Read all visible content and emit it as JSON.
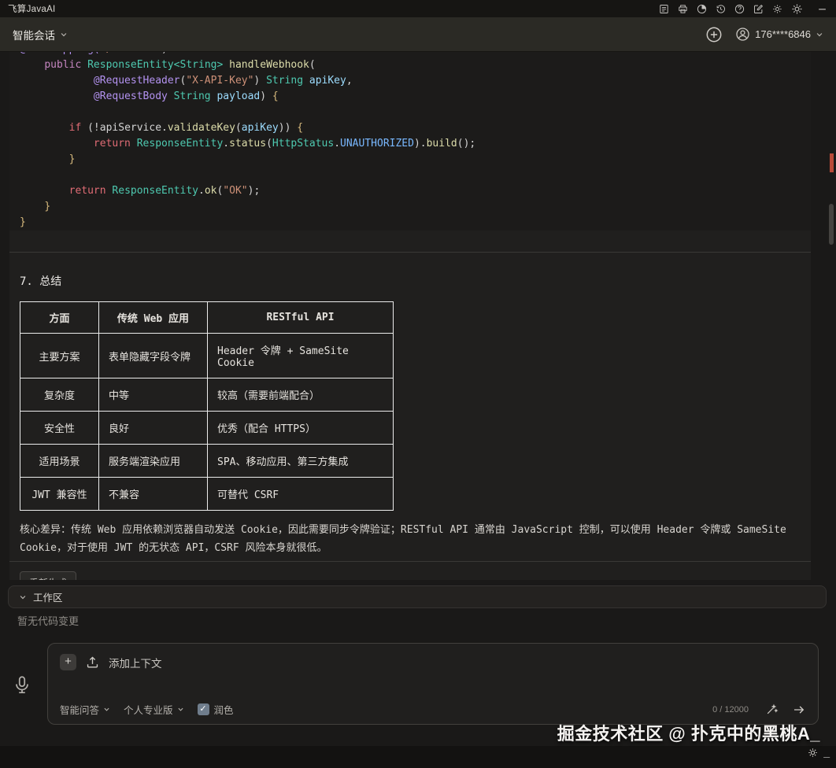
{
  "titlebar": {
    "title": "飞算JavaAI",
    "icons": [
      "report-icon",
      "printer-icon",
      "usage-pie-icon",
      "history-icon",
      "help-icon",
      "edit-icon",
      "theme-gear-icon",
      "settings-gear-icon",
      "minimize-icon"
    ]
  },
  "toolbar": {
    "session_label": "智能会话",
    "account_id": "176****6846"
  },
  "code": {
    "lines": [
      [
        {
          "t": "@PostMapping(",
          "c": "an"
        },
        {
          "t": "\"/webhook\"",
          "c": "str"
        },
        {
          "t": ")",
          "c": "pl"
        }
      ],
      [
        {
          "t": "    ",
          "c": "pl"
        },
        {
          "t": "public",
          "c": "kw"
        },
        {
          "t": " ",
          "c": "pl"
        },
        {
          "t": "ResponseEntity<String>",
          "c": "type"
        },
        {
          "t": " ",
          "c": "pl"
        },
        {
          "t": "handleWebhook",
          "c": "fn"
        },
        {
          "t": "(",
          "c": "pl"
        }
      ],
      [
        {
          "t": "            ",
          "c": "pl"
        },
        {
          "t": "@RequestHeader",
          "c": "an"
        },
        {
          "t": "(",
          "c": "pl"
        },
        {
          "t": "\"X-API-Key\"",
          "c": "str"
        },
        {
          "t": ") ",
          "c": "pl"
        },
        {
          "t": "String",
          "c": "type"
        },
        {
          "t": " ",
          "c": "pl"
        },
        {
          "t": "apiKey",
          "c": "var"
        },
        {
          "t": ",",
          "c": "pl"
        }
      ],
      [
        {
          "t": "            ",
          "c": "pl"
        },
        {
          "t": "@RequestBody",
          "c": "an"
        },
        {
          "t": " ",
          "c": "pl"
        },
        {
          "t": "String",
          "c": "type"
        },
        {
          "t": " ",
          "c": "pl"
        },
        {
          "t": "payload",
          "c": "var"
        },
        {
          "t": ") ",
          "c": "pl"
        },
        {
          "t": "{",
          "c": "br"
        }
      ],
      [],
      [
        {
          "t": "        ",
          "c": "pl"
        },
        {
          "t": "if",
          "c": "ctl"
        },
        {
          "t": " (!apiService.",
          "c": "pl"
        },
        {
          "t": "validateKey",
          "c": "fn"
        },
        {
          "t": "(",
          "c": "pl"
        },
        {
          "t": "apiKey",
          "c": "var"
        },
        {
          "t": ")) ",
          "c": "pl"
        },
        {
          "t": "{",
          "c": "br"
        }
      ],
      [
        {
          "t": "            ",
          "c": "pl"
        },
        {
          "t": "return",
          "c": "ctl"
        },
        {
          "t": " ",
          "c": "pl"
        },
        {
          "t": "ResponseEntity",
          "c": "type"
        },
        {
          "t": ".",
          "c": "pl"
        },
        {
          "t": "status",
          "c": "fn"
        },
        {
          "t": "(",
          "c": "pl"
        },
        {
          "t": "HttpStatus",
          "c": "type"
        },
        {
          "t": ".",
          "c": "pl"
        },
        {
          "t": "UNAUTHORIZED",
          "c": "const"
        },
        {
          "t": ").",
          "c": "pl"
        },
        {
          "t": "build",
          "c": "fn"
        },
        {
          "t": "();",
          "c": "pl"
        }
      ],
      [
        {
          "t": "        ",
          "c": "pl"
        },
        {
          "t": "}",
          "c": "br"
        }
      ],
      [],
      [
        {
          "t": "        ",
          "c": "pl"
        },
        {
          "t": "return",
          "c": "ctl"
        },
        {
          "t": " ",
          "c": "pl"
        },
        {
          "t": "ResponseEntity",
          "c": "type"
        },
        {
          "t": ".",
          "c": "pl"
        },
        {
          "t": "ok",
          "c": "fn"
        },
        {
          "t": "(",
          "c": "pl"
        },
        {
          "t": "\"OK\"",
          "c": "str"
        },
        {
          "t": ");",
          "c": "pl"
        }
      ],
      [
        {
          "t": "    ",
          "c": "pl"
        },
        {
          "t": "}",
          "c": "br"
        }
      ],
      [
        {
          "t": "}",
          "c": "br"
        }
      ]
    ]
  },
  "summary": {
    "heading": "7. 总结",
    "table": {
      "headers": [
        "方面",
        "传统 Web 应用",
        "RESTful API"
      ],
      "rows": [
        [
          "主要方案",
          "表单隐藏字段令牌",
          "Header 令牌 + SameSite Cookie"
        ],
        [
          "复杂度",
          "中等",
          "较高（需要前端配合）"
        ],
        [
          "安全性",
          "良好",
          "优秀（配合 HTTPS）"
        ],
        [
          "适用场景",
          "服务端渲染应用",
          "SPA、移动应用、第三方集成"
        ],
        [
          "JWT 兼容性",
          "不兼容",
          "可替代 CSRF"
        ]
      ]
    },
    "note": "核心差异：传统 Web 应用依赖浏览器自动发送 Cookie，因此需要同步令牌验证；RESTful API 通常由 JavaScript 控制，可以使用 Header 令牌或 SameSite Cookie，对于使用 JWT 的无状态 API，CSRF 风险本身就很低。",
    "regenerate_label": "重新生成"
  },
  "workspace": {
    "title": "工作区",
    "empty_text": "暂无代码变更"
  },
  "composer": {
    "plus_glyph": "+",
    "add_context": "添加上下文",
    "mode_label": "智能问答",
    "plan_label": "个人专业版",
    "polish_label": "润色",
    "polish_checked": true,
    "check_glyph": "✓",
    "counter": "0 / 12000"
  },
  "watermark": {
    "text": "掘金技术社区 @ 扑克中的黑桃A_",
    "corner": "_"
  },
  "colors": {
    "syntax": {
      "an": "#b392f0",
      "kw": "#c586c0",
      "ctl": "#e06c75",
      "type": "#4ec9b0",
      "fn": "#dcdcaa",
      "str": "#ce9178",
      "var": "#9cdcfe",
      "const": "#79b8ff",
      "br": "#d7ba7d",
      "pl": "#d4d4d4"
    },
    "scroll_marker": "#b94a38",
    "checkbox": "#6f7d8c"
  }
}
